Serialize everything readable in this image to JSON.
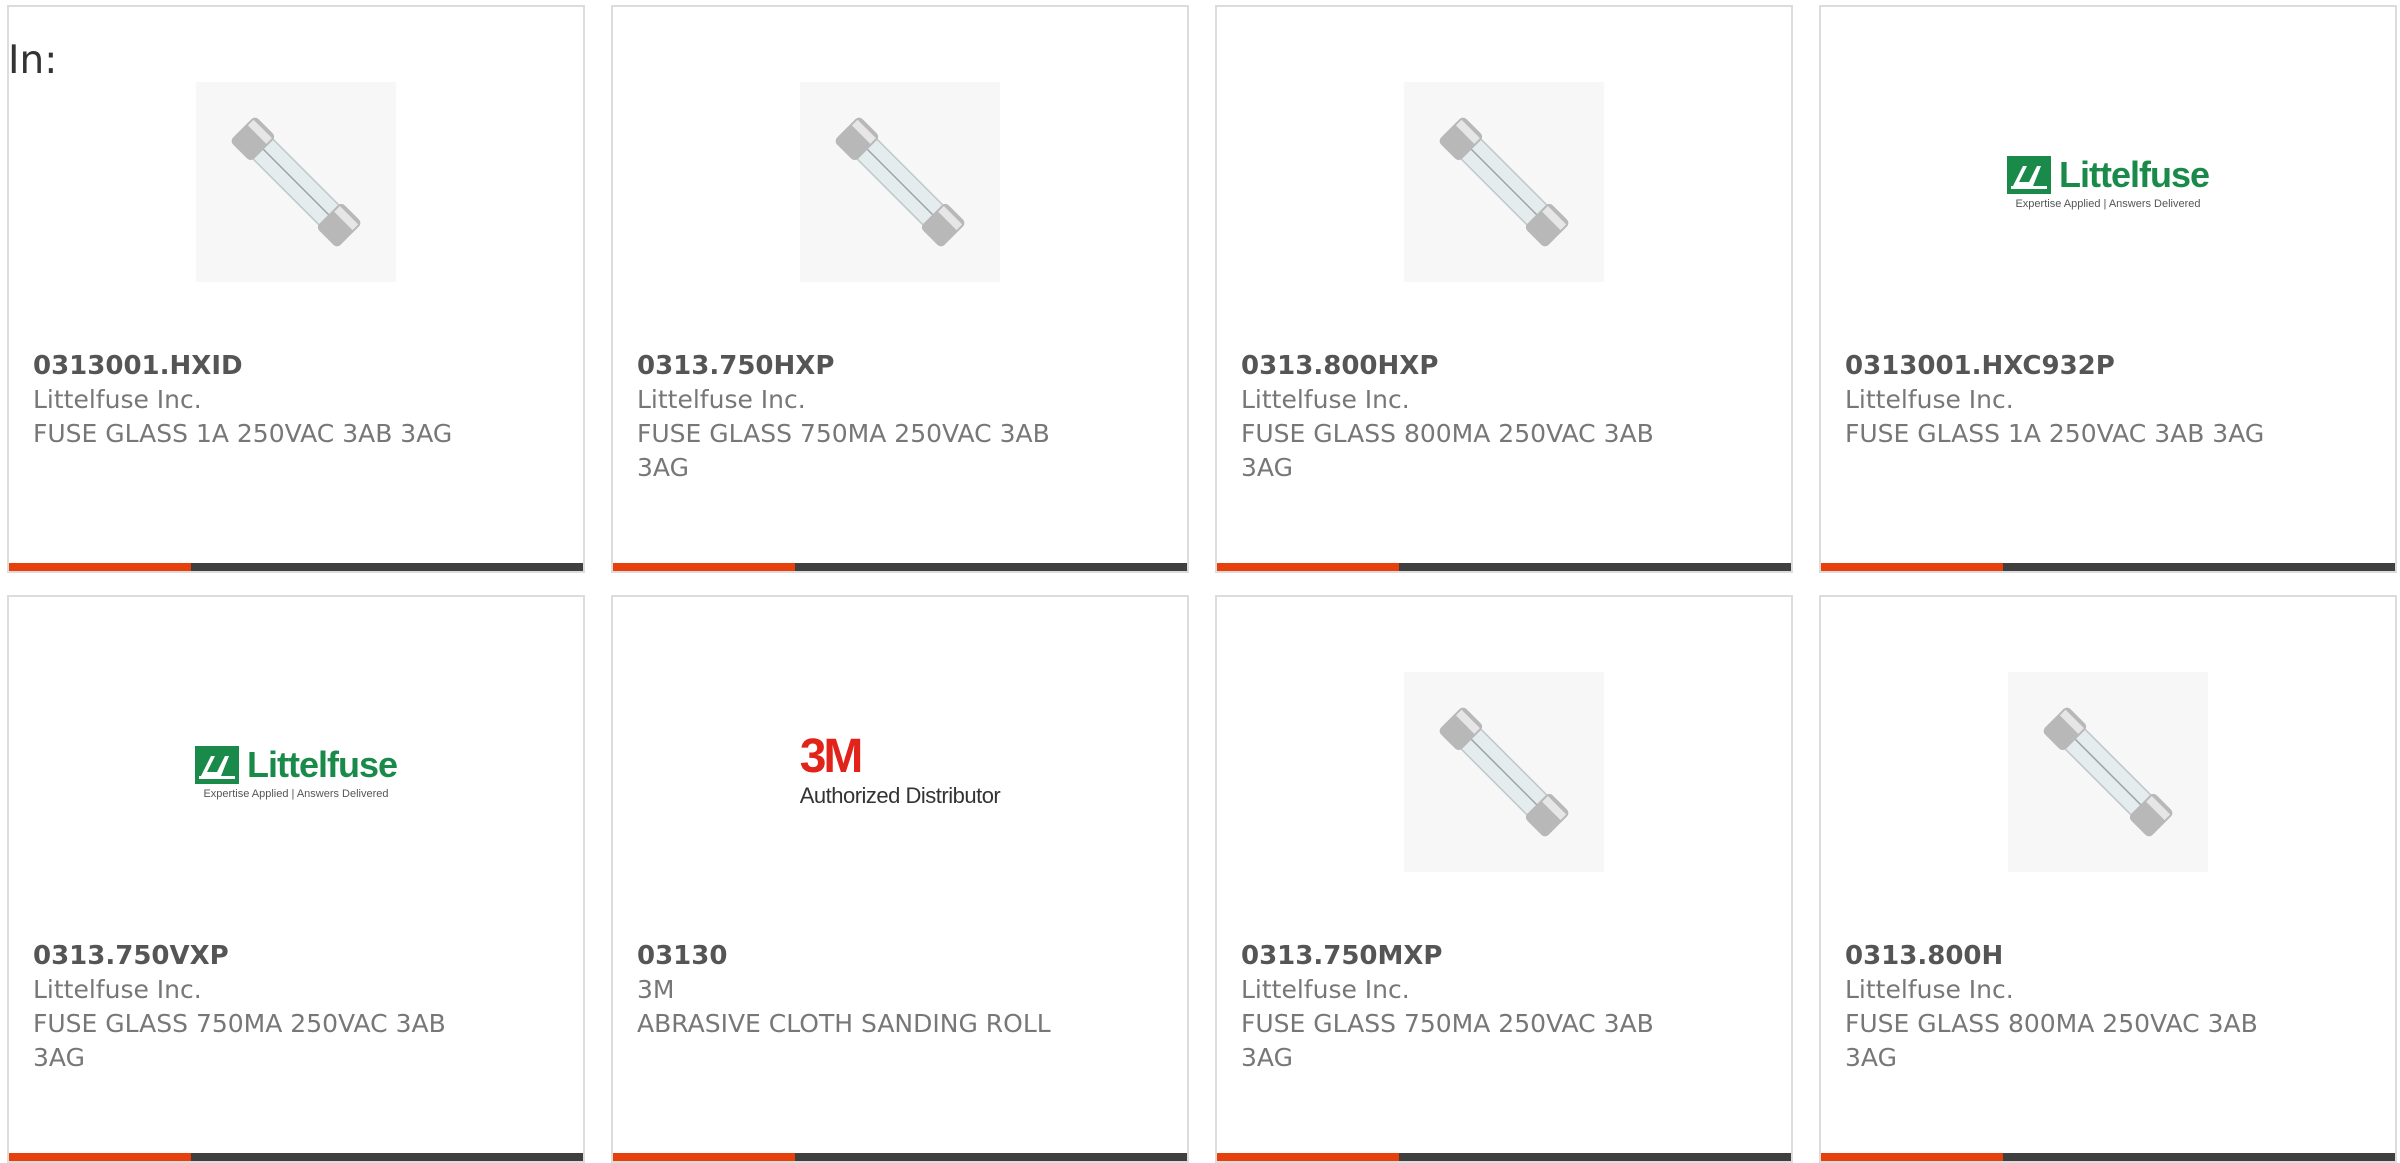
{
  "header": {
    "in_label": "In:"
  },
  "brand_colors": {
    "accent_bar": "#e8400c",
    "dark_bar": "#3f3f3f",
    "littelfuse_green": "#1a8a4a",
    "threem_red": "#e2231a"
  },
  "logos": {
    "littelfuse_word": "Littelfuse",
    "littelfuse_tag": "Expertise Applied | Answers Delivered",
    "threem_word": "3M",
    "threem_tag": "Authorized Distributor"
  },
  "products": [
    {
      "part_number": "0313001.HXID",
      "manufacturer": "Littelfuse Inc.",
      "description": "FUSE GLASS 1A 250VAC 3AB 3AG",
      "image": "glass-fuse-image"
    },
    {
      "part_number": "0313.750HXP",
      "manufacturer": "Littelfuse Inc.",
      "description": "FUSE GLASS 750MA 250VAC 3AB 3AG",
      "image": "glass-fuse-image"
    },
    {
      "part_number": "0313.800HXP",
      "manufacturer": "Littelfuse Inc.",
      "description": "FUSE GLASS 800MA 250VAC 3AB 3AG",
      "image": "glass-fuse-image"
    },
    {
      "part_number": "0313001.HXC932P",
      "manufacturer": "Littelfuse Inc.",
      "description": "FUSE GLASS 1A 250VAC 3AB 3AG",
      "image": "littelfuse-logo"
    },
    {
      "part_number": "0313.750VXP",
      "manufacturer": "Littelfuse Inc.",
      "description": "FUSE GLASS 750MA 250VAC 3AB 3AG",
      "image": "littelfuse-logo"
    },
    {
      "part_number": "03130",
      "manufacturer": "3M",
      "description": "ABRASIVE CLOTH SANDING ROLL",
      "image": "3m-logo"
    },
    {
      "part_number": "0313.750MXP",
      "manufacturer": "Littelfuse Inc.",
      "description": "FUSE GLASS 750MA 250VAC 3AB 3AG",
      "image": "glass-fuse-image"
    },
    {
      "part_number": "0313.800H",
      "manufacturer": "Littelfuse Inc.",
      "description": "FUSE GLASS 800MA 250VAC 3AB 3AG",
      "image": "glass-fuse-image"
    }
  ]
}
